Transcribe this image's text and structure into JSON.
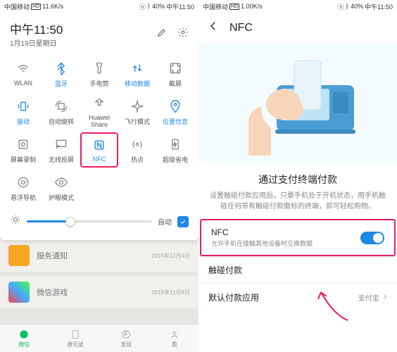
{
  "left": {
    "status": {
      "carrier": "中国移动",
      "net": "11.6K/s",
      "batt": "40%",
      "time": "中午11:50"
    },
    "qs": {
      "time": "中午11:50",
      "date": "1月19日星期日",
      "tiles": [
        {
          "label": "WLAN",
          "icon": "wifi",
          "active": false
        },
        {
          "label": "蓝牙",
          "icon": "bluetooth",
          "active": true
        },
        {
          "label": "手电筒",
          "icon": "flashlight",
          "active": false
        },
        {
          "label": "移动数据",
          "icon": "data",
          "active": true
        },
        {
          "label": "截屏",
          "icon": "screenshot",
          "active": false
        },
        {
          "label": "振动",
          "icon": "vibrate",
          "active": true
        },
        {
          "label": "自动旋转",
          "icon": "rotate",
          "active": false
        },
        {
          "label": "Huawei Share",
          "icon": "share",
          "active": false
        },
        {
          "label": "飞行模式",
          "icon": "airplane",
          "active": false
        },
        {
          "label": "位置信息",
          "icon": "location",
          "active": true
        },
        {
          "label": "屏幕录制",
          "icon": "record",
          "active": false
        },
        {
          "label": "无线投屏",
          "icon": "cast",
          "active": false
        },
        {
          "label": "NFC",
          "icon": "nfc",
          "active": true,
          "highlighted": true
        },
        {
          "label": "热点",
          "icon": "hotspot",
          "active": false
        },
        {
          "label": "超级省电",
          "icon": "powersave",
          "active": false
        },
        {
          "label": "悬浮导航",
          "icon": "floatnav",
          "active": false
        },
        {
          "label": "护眼模式",
          "icon": "eye",
          "active": false
        }
      ],
      "auto_label": "自动"
    },
    "bg": {
      "row1": {
        "title": "服务通知",
        "date": "2019年12月4日"
      },
      "row2": {
        "title": "微信游戏",
        "date": "2019年11月8日"
      }
    },
    "nav": [
      "微信",
      "通讯录",
      "发现",
      "我"
    ]
  },
  "right": {
    "status": {
      "carrier": "中国移动",
      "net": "1.00K/s",
      "batt": "40%",
      "time": "中午11:50"
    },
    "title": "NFC",
    "desc_title": "通过支付终端付款",
    "desc_text": "设置触碰付款应用后，只要手机处于开机状态，用手机触碰任何带有触碰付款徽标的终端，即可轻松购物。",
    "rows": {
      "nfc": {
        "title": "NFC",
        "sub": "允许手机在接触其他设备时交换数据"
      },
      "tap": {
        "title": "触碰付款"
      },
      "default": {
        "title": "默认付款应用",
        "extra": "支付宝"
      }
    }
  }
}
